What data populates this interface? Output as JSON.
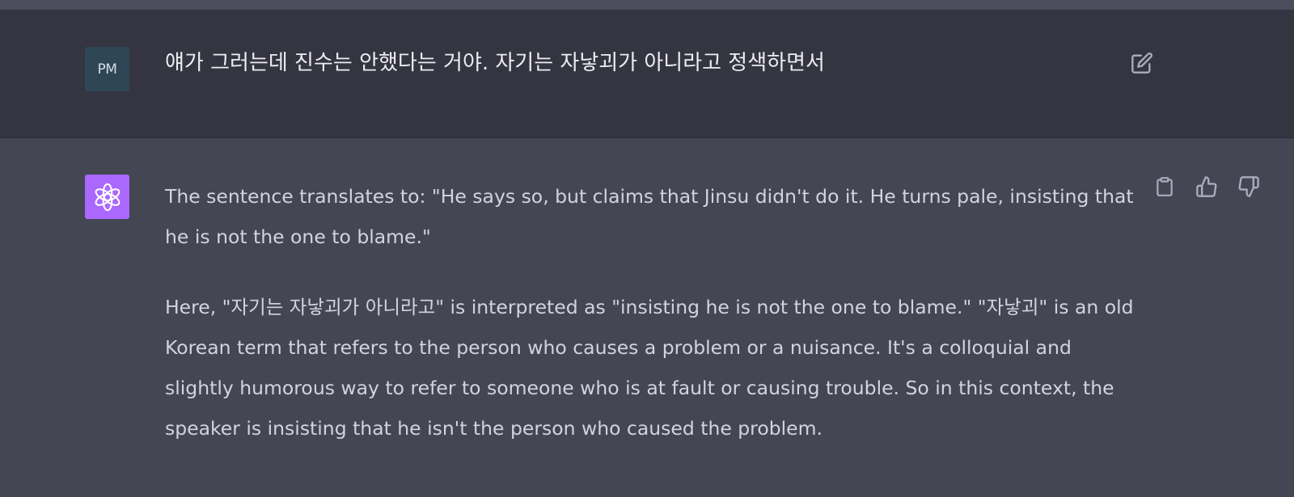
{
  "user_message": {
    "avatar_initials": "PM",
    "text": "얘가 그러는데 진수는 안했다는 거야. 자기는 자낳괴가 아니라고 정색하면서",
    "edit_icon": "edit-icon"
  },
  "assistant_message": {
    "avatar_icon": "openai-logo-icon",
    "paragraphs": [
      "The sentence translates to: \"He says so, but claims that Jinsu didn't do it. He turns pale, insisting that he is not the one to blame.\"",
      "Here, \"자기는 자낳괴가 아니라고\" is interpreted as \"insisting he is not the one to blame.\" \"자낳괴\" is an old Korean term that refers to the person who causes a problem or a nuisance. It's a colloquial and slightly humorous way to refer to someone who is at fault or causing trouble. So in this context, the speaker is insisting that he isn't the person who caused the problem."
    ],
    "action_icons": [
      "clipboard-icon",
      "thumbs-up-icon",
      "thumbs-down-icon"
    ]
  },
  "colors": {
    "user_row_bg": "#343541",
    "assistant_row_bg": "#444654",
    "gpt_avatar_bg": "#ab68ff",
    "user_avatar_bg": "#2f4656"
  }
}
